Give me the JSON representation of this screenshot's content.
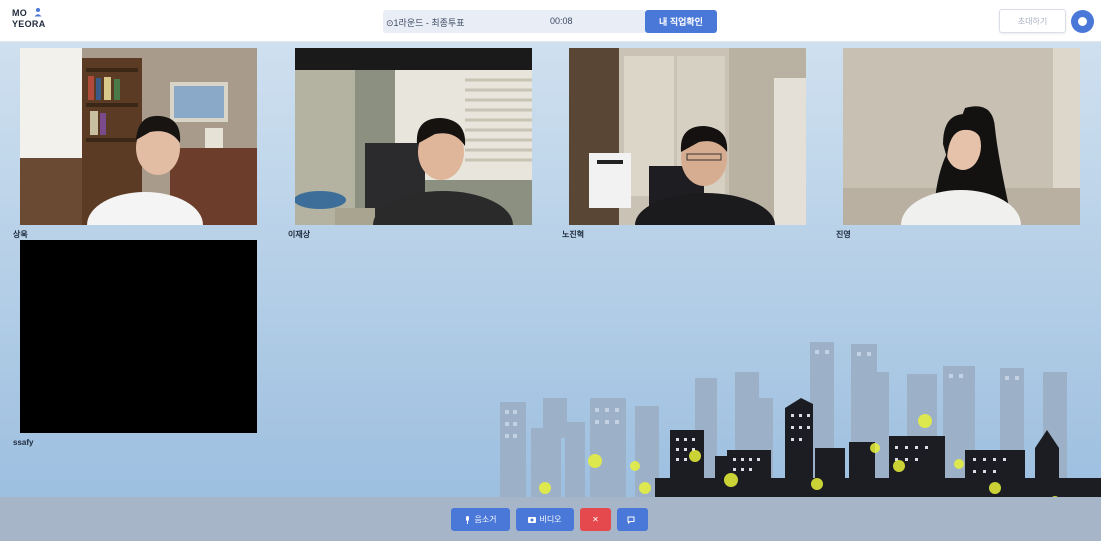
{
  "header": {
    "logo_line1": "MO",
    "logo_line2": "YEORA",
    "round_label": "⊙1라운드 - 최종투표",
    "timer": "00:08",
    "my_job_button": "내 직업확인",
    "invite_button": "초대하기"
  },
  "participants": [
    {
      "name": "상욱"
    },
    {
      "name": "이재상"
    },
    {
      "name": "노진혁"
    },
    {
      "name": "진영"
    },
    {
      "name": "ssafy"
    }
  ],
  "controls": {
    "mic_label": "음소거",
    "video_label": "비디오",
    "leave_label": "✕",
    "chat_label": ""
  },
  "colors": {
    "accent": "#4a78d8",
    "danger": "#e5484d",
    "bottom_bar": "#a7b5c9"
  },
  "icons": {
    "logo": "person-icon",
    "settings": "settings-icon",
    "mic": "microphone-icon",
    "video": "camera-icon",
    "leave": "close-icon",
    "chat": "chat-icon"
  }
}
